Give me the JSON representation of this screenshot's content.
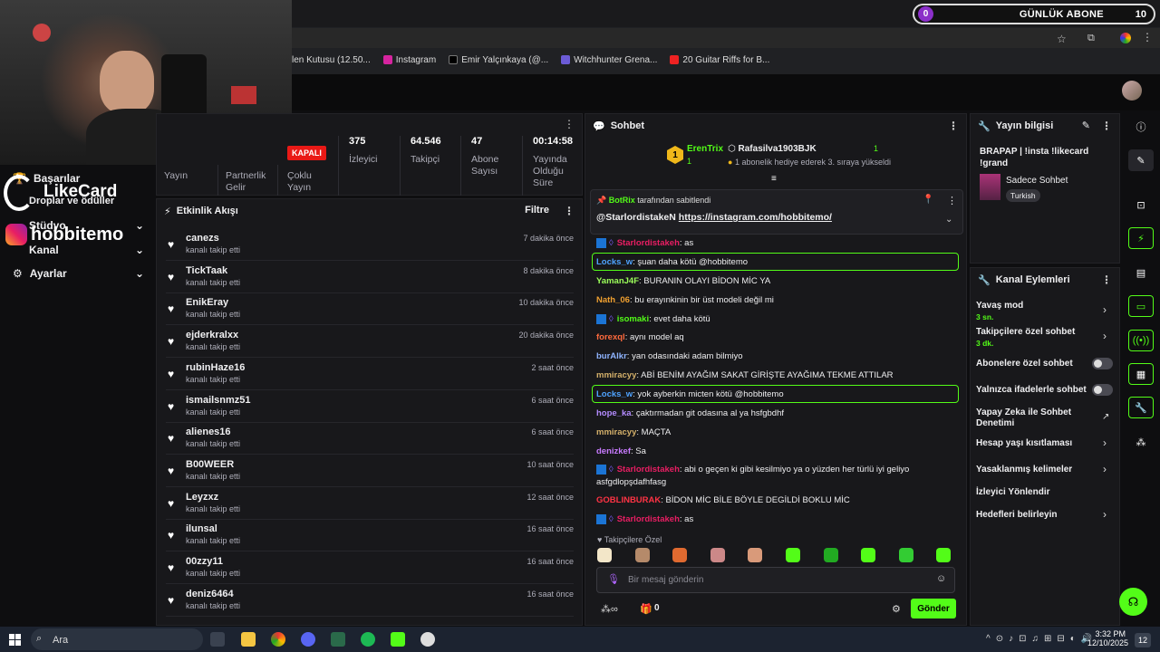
{
  "sub_banner": {
    "count_left": "0",
    "title": "GÜNLÜK ABONE",
    "count_right": "10"
  },
  "bookmarks": [
    {
      "label": "len Kutusu (12.50...",
      "color": "#aaa"
    },
    {
      "label": "Instagram",
      "color": "#d6249f"
    },
    {
      "label": "Emir Yalçınkaya (@...",
      "color": "#fff"
    },
    {
      "label": "Witchhunter Grena...",
      "color": "#6b5bd6"
    },
    {
      "label": "20 Guitar Riffs for B...",
      "color": "#e22"
    }
  ],
  "left_nav": [
    {
      "label": "Başarılar"
    },
    {
      "label": "Droplar ve ödüller"
    },
    {
      "label": "Stüdyo"
    },
    {
      "label": "Kanal"
    },
    {
      "label": "Ayarlar"
    }
  ],
  "overlay": {
    "likecard": "LikeCard",
    "insta": "hobbitemo"
  },
  "stream": {
    "live_badge": "KAPALI",
    "labels": {
      "yayin": "Yayın",
      "partner": "Partnerlik Gelir",
      "coklu": "Çoklu Yayın"
    },
    "stats": [
      {
        "value": "375",
        "label": "İzleyici"
      },
      {
        "value": "64.546",
        "label": "Takipçi"
      },
      {
        "value": "47",
        "label": "Abone Sayısı"
      },
      {
        "value": "00:14:58",
        "label": "Yayında Olduğu Süre"
      }
    ]
  },
  "activity": {
    "title": "Etkinlik Akışı",
    "filter": "Filtre",
    "items": [
      {
        "name": "canezs",
        "sub": "kanalı takip etti",
        "time": "7 dakika önce"
      },
      {
        "name": "TickTaak",
        "sub": "kanalı takip etti",
        "time": "8 dakika önce"
      },
      {
        "name": "EnikEray",
        "sub": "kanalı takip etti",
        "time": "10 dakika önce"
      },
      {
        "name": "ejderkralxx",
        "sub": "kanalı takip etti",
        "time": "20 dakika önce"
      },
      {
        "name": "rubinHaze16",
        "sub": "kanalı takip etti",
        "time": "2 saat önce"
      },
      {
        "name": "ismailsnmz51",
        "sub": "kanalı takip etti",
        "time": "6 saat önce"
      },
      {
        "name": "alienes16",
        "sub": "kanalı takip etti",
        "time": "6 saat önce"
      },
      {
        "name": "B00WEER",
        "sub": "kanalı takip etti",
        "time": "10 saat önce"
      },
      {
        "name": "Leyzxz",
        "sub": "kanalı takip etti",
        "time": "12 saat önce"
      },
      {
        "name": "ilunsal",
        "sub": "kanalı takip etti",
        "time": "16 saat önce"
      },
      {
        "name": "00zzy11",
        "sub": "kanalı takip etti",
        "time": "16 saat önce"
      },
      {
        "name": "deniz6464",
        "sub": "kanalı takip etti",
        "time": "16 saat önce"
      }
    ]
  },
  "chat": {
    "title": "Sohbet",
    "gift": {
      "user1": "ErenTrix",
      "user1_count": "1",
      "rank": "1",
      "user2": "Rafasilva1903BJK",
      "user2_count": "1",
      "text": "1 abonelik hediye ederek 3. sıraya yükseldi"
    },
    "pinned": {
      "by": "BotRix",
      "by_suffix": "tarafından sabitlendi",
      "mention": "@StarlordistakeN",
      "link": "https://instagram.com/hobbitemo/"
    },
    "messages": [
      {
        "user": "Starlordistakeh",
        "color": "#e91e63",
        "text": "as"
      },
      {
        "user": "Locks_w",
        "color": "#4fa3ff",
        "text": "şuan daha kötü @hobbitemo"
      },
      {
        "user": "YamanJ4F",
        "color": "#9cff5a",
        "text": "BURANIN OLAYI BİDON MİC YA"
      },
      {
        "user": "Nath_06",
        "color": "#f0a030",
        "text": "bu erayınkinin bir üst modeli değil mi"
      },
      {
        "user": "isomaki",
        "color": "#53fc18",
        "text": "evet daha kötü"
      },
      {
        "user": "forexql",
        "color": "#ff6a3d",
        "text": "aynı model aq"
      },
      {
        "user": "burAlkr",
        "color": "#8fb4ff",
        "text": "yan odasındaki adam bilmiyo"
      },
      {
        "user": "mmiracyy",
        "color": "#d4b06a",
        "text": "ABİ BENİM AYAĞIM SAKAT GİRİŞTE AYAĞIMA TEKME ATTILAR"
      },
      {
        "user": "Locks_w",
        "color": "#4fa3ff",
        "text": "yok ayberkin micten kötü @hobbitemo"
      },
      {
        "user": "hope_ka",
        "color": "#b48cff",
        "text": "çaktırmadan git odasına al ya hsfgbdhf"
      },
      {
        "user": "mmiracyy",
        "color": "#d4b06a",
        "text": "MAÇTA"
      },
      {
        "user": "denizkef",
        "color": "#c87bff",
        "text": "Sa"
      },
      {
        "user": "Starlordistakeh",
        "color": "#e91e63",
        "text": "abi o geçen ki gibi kesilmiyo ya o yüzden her türlü iyi geliyo asfgdlopşdafhfasg"
      },
      {
        "user": "GOBLINBURAK",
        "color": "#ff3344",
        "text": "BİDON MİC BİLE BÖYLE DEGİLDİ BOKLU MİC"
      },
      {
        "user": "Starlordistakeh",
        "color": "#e91e63",
        "text": "as"
      }
    ],
    "followers_only": "Takipçilere Özel",
    "input_placeholder": "Bir mesaj gönderin",
    "points": "0",
    "send_label": "Gönder"
  },
  "stream_info": {
    "title": "Yayın bilgisi",
    "stream_title": "BRAPAP | !insta !likecard !grand",
    "category": "Sadece Sohbet",
    "tag": "Turkish"
  },
  "channel_actions": {
    "title": "Kanal Eylemleri",
    "slow_mode": {
      "label": "Yavaş mod",
      "sub": "3 sn."
    },
    "followers_chat": {
      "label": "Takipçilere özel sohbet",
      "sub": "3 dk."
    },
    "sub_chat": "Abonelere özel sohbet",
    "emote_chat": "Yalnızca ifadelerle sohbet",
    "ai_chat": "Yapay Zeka ile Sohbet Denetimi",
    "age": "Hesap yaşı kısıtlaması",
    "banned": "Yasaklanmış kelimeler",
    "viewer": "İzleyici Yönlendir",
    "goals": "Hedefleri belirleyin"
  },
  "taskbar": {
    "search": "Ara",
    "time": "3:32 PM",
    "date": "12/10/2025",
    "notif": "12"
  }
}
